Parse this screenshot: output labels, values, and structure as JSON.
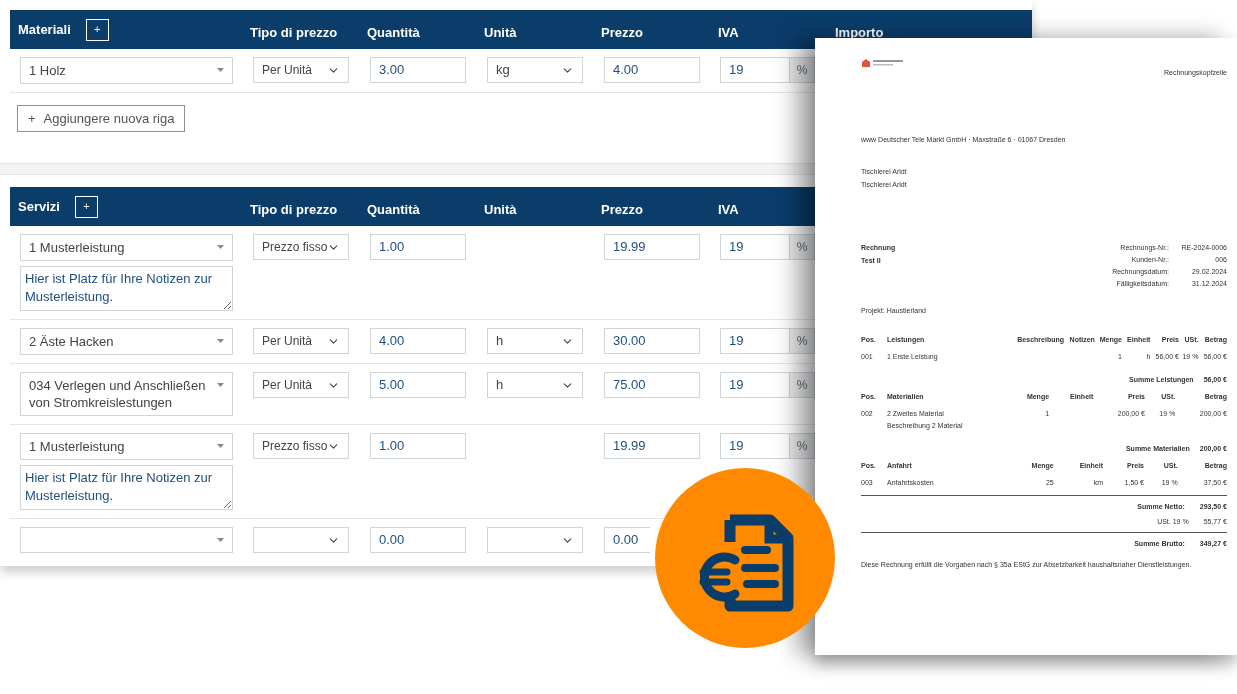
{
  "sections": [
    {
      "title": "Materiali",
      "add_icon": "+",
      "columns": [
        "Tipo di prezzo",
        "Quantità",
        "Unità",
        "Prezzo",
        "IVA",
        "Importo"
      ],
      "rows": [
        {
          "item": "1 Holz",
          "price_type": "Per Unità",
          "quantity": "3.00",
          "has_unit": true,
          "unit": "kg",
          "price": "4.00",
          "vat_field": true,
          "vat": "19",
          "vat_suffix": "%"
        }
      ],
      "add_row": {
        "icon": "+",
        "label": "Aggiungere nuova riga"
      }
    },
    {
      "title": "Servizi",
      "add_icon": "+",
      "columns": [
        "Tipo di prezzo",
        "Quantità",
        "Unità",
        "Prezzo",
        "IVA"
      ],
      "rows": [
        {
          "item": "1 Musterleistung",
          "price_type": "Prezzo fisso",
          "quantity": "1.00",
          "has_unit": false,
          "price": "19.99",
          "vat_field": true,
          "vat": "19",
          "vat_suffix": "%",
          "notes": "Hier ist Platz für Ihre Notizen zur Musterleistung."
        },
        {
          "item": "2 Äste Hacken",
          "price_type": "Per Unità",
          "quantity": "4.00",
          "has_unit": true,
          "unit": "h",
          "price": "30.00",
          "vat_field": true,
          "vat": "19",
          "vat_suffix": "%"
        },
        {
          "item": "034 Verlegen und Anschließen von Stromkreislestungen",
          "price_type": "Per Unità",
          "quantity": "5.00",
          "has_unit": true,
          "unit": "h",
          "price": "75.00",
          "vat_field": true,
          "vat": "19",
          "vat_suffix": "%"
        },
        {
          "item": "1 Musterleistung",
          "price_type": "Prezzo fisso",
          "quantity": "1.00",
          "has_unit": false,
          "price": "19.99",
          "vat_field": true,
          "vat": "19",
          "vat_suffix": "%",
          "notes": "Hier ist Platz für Ihre Notizen zur Musterleistung."
        },
        {
          "quantity": "0.00",
          "has_unit": true,
          "price": "0.00",
          "vat_field": false
        }
      ]
    }
  ],
  "invoice": {
    "header": "Rechnungskopfzeile",
    "sender_line": "www Deutscher Tele Markt GmbH · Maxstraße 6 · 01067 Dresden",
    "recipient": [
      "Tischlerei Arldt",
      "Tischlerei Arldt"
    ],
    "title": "Rechnung",
    "subtitle": "Test II",
    "meta": [
      {
        "label": "Rechnungs-Nr.:",
        "value": "RE-2024-0006"
      },
      {
        "label": "Kunden-Nr.:",
        "value": "006"
      },
      {
        "label": "Rechnungsdatum:",
        "value": "29.02.2024"
      },
      {
        "label": "Fälligkeitsdatum:",
        "value": "31.12.2024"
      }
    ],
    "project": "Projekt: Haustierland",
    "blocks": [
      {
        "columns": [
          "Pos.",
          "Leistungen",
          "Beschreibung",
          "Notizen",
          "Menge",
          "Einheit",
          "Preis",
          "USt.",
          "Betrag"
        ],
        "rows": [
          {
            "cells": [
              "001",
              "1 Erste Leistung",
              "",
              "",
              "1",
              "h",
              "56,00 €",
              "19 %",
              "56,00 €"
            ]
          }
        ],
        "sum_label": "Summe Leistungen",
        "sum_value": "56,00 €"
      },
      {
        "columns": [
          "Pos.",
          "Materialien",
          "Menge",
          "Einheit",
          "Preis",
          "USt.",
          "Betrag"
        ],
        "rows": [
          {
            "cells": [
              "002",
              "2 Zweites Material",
              "1",
              "",
              "200,00 €",
              "19 %",
              "200,00 €"
            ],
            "description": "Beschreibung 2 Material"
          }
        ],
        "sum_label": "Summe Materialien",
        "sum_value": "200,00 €"
      },
      {
        "columns": [
          "Pos.",
          "Anfahrt",
          "Menge",
          "Einheit",
          "Preis",
          "USt.",
          "Betrag"
        ],
        "rows": [
          {
            "cells": [
              "003",
              "Anfahrtskosten",
              "25",
              "km",
              "1,50 €",
              "19 %",
              "37,50 €"
            ]
          }
        ]
      }
    ],
    "net_label": "Summe Netto:",
    "net_value": "293,50 €",
    "tax_label": "USt. 19 %",
    "tax_value": "55,77 €",
    "gross_label": "Summe Brutto:",
    "gross_value": "349,27 €",
    "footer": "Diese Rechnung erfüllt die Vorgaben nach § 35a EStG zur Absetzbarkeit haushaltsnaher Dienstleistungen."
  }
}
